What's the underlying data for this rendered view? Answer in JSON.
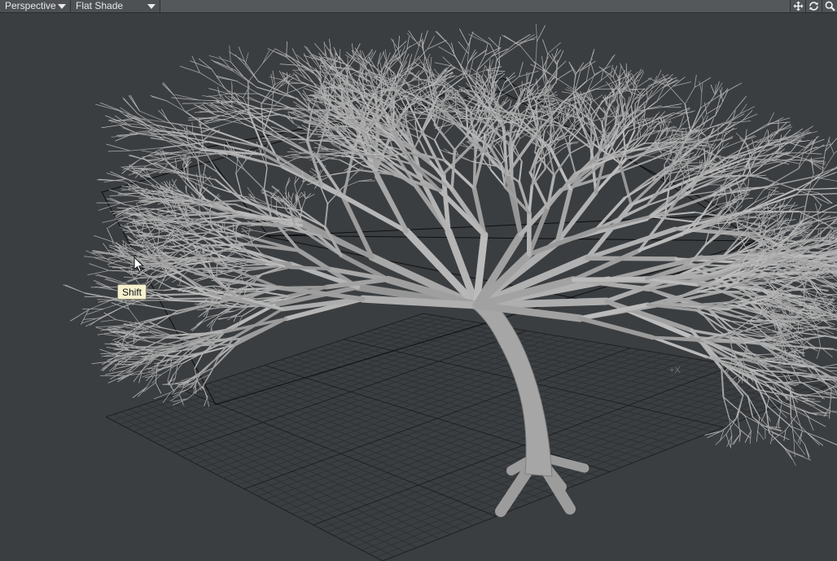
{
  "toolbar": {
    "view_mode": "Perspective",
    "shading_mode": "Flat Shade",
    "icons": [
      "move-icon",
      "rotate-icon",
      "zoom-icon"
    ]
  },
  "viewport": {
    "tooltip": "Shift",
    "axis_label": "+X"
  },
  "colors": {
    "background": "#3b3e41",
    "toolbar": "#55585b",
    "grid": "#2e3134",
    "tree": "#a9a9a9",
    "tooltip_bg": "#f5f1cf"
  }
}
